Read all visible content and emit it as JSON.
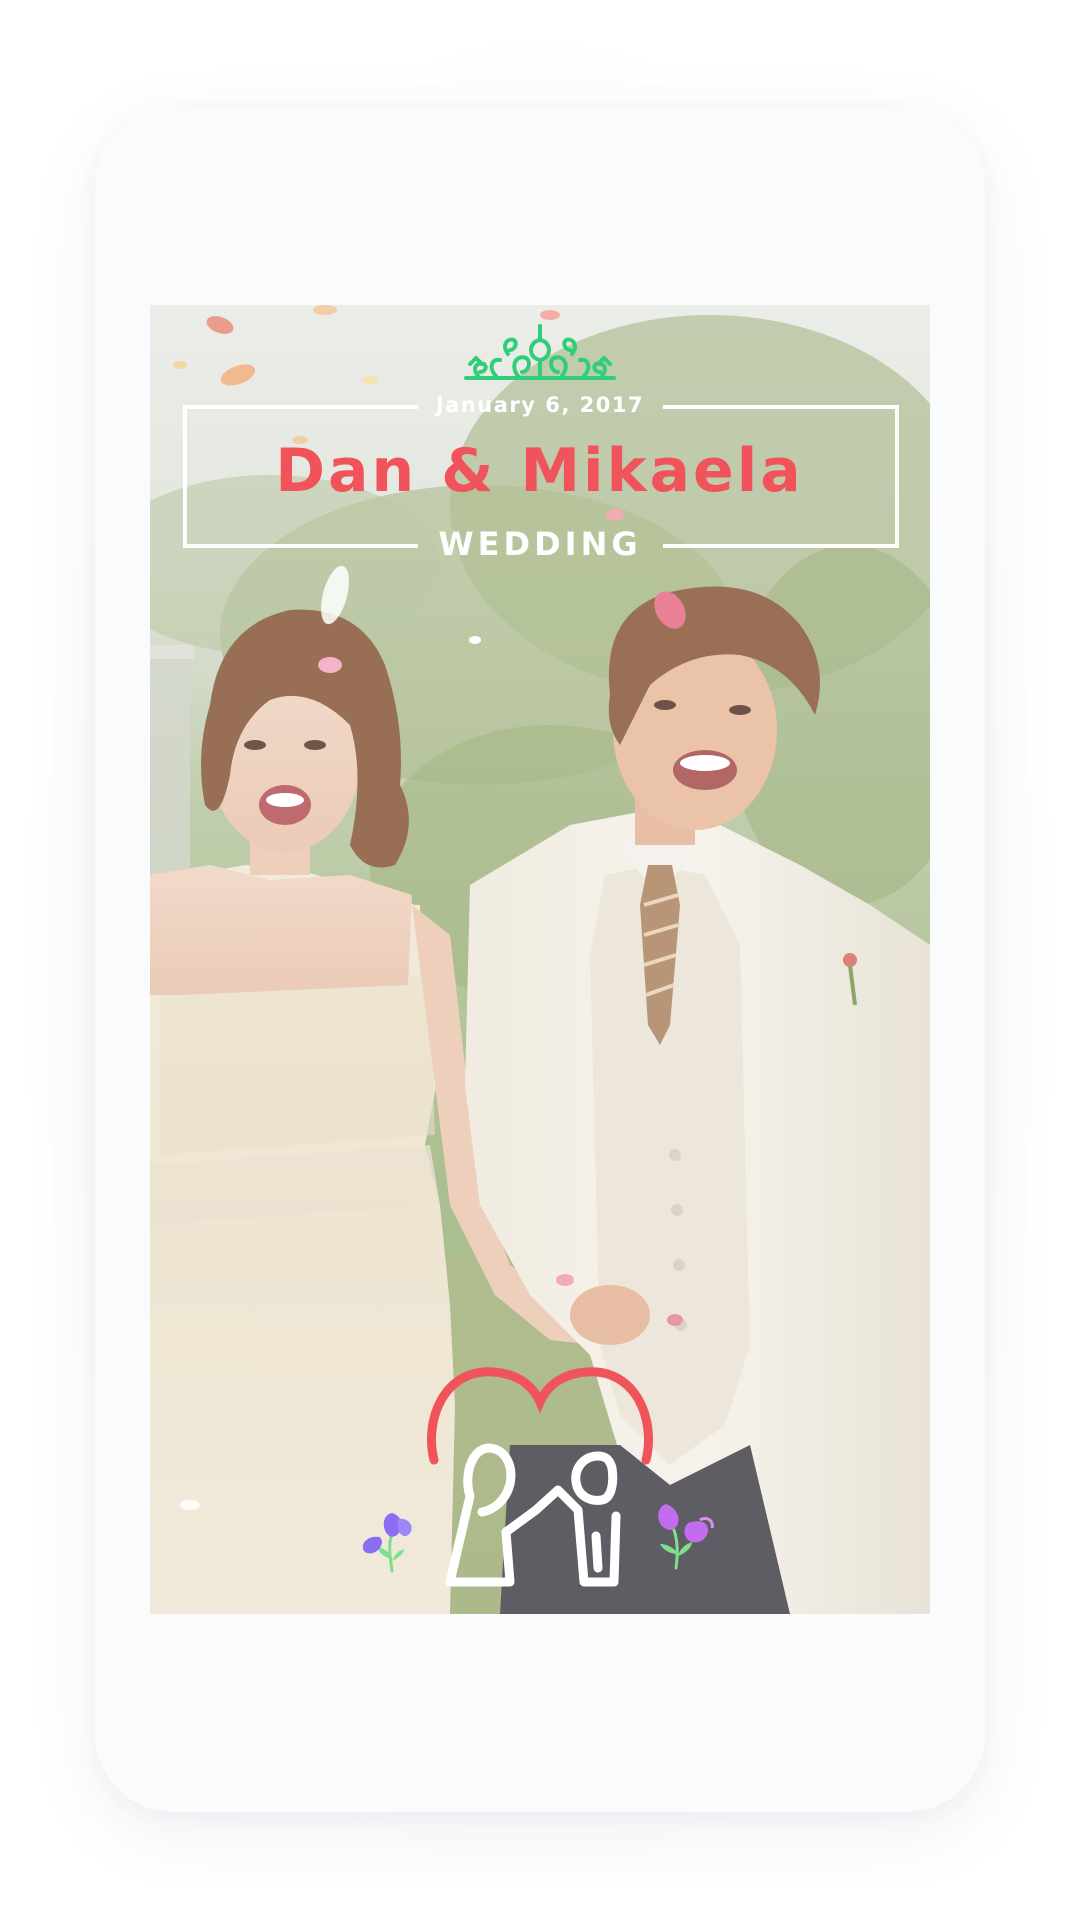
{
  "overlay": {
    "date": "January 6, 2017",
    "names": "Dan & Mikaela",
    "event": "WEDDING"
  },
  "icons": {
    "top_ornament": "crown-flourish-icon",
    "couple": "couple-heart-icon",
    "flowers_left": "tulip-flowers-icon",
    "flowers_right": "tulip-flowers-icon"
  },
  "colors": {
    "names": "#f0535a",
    "heart": "#f0535a",
    "crown": "#2ecf78",
    "frame": "#ffffff",
    "flower_left": "#8a6df2",
    "flower_right": "#c46cf0",
    "leaves": "#7ee08a",
    "card_background": "#fafbfc"
  }
}
